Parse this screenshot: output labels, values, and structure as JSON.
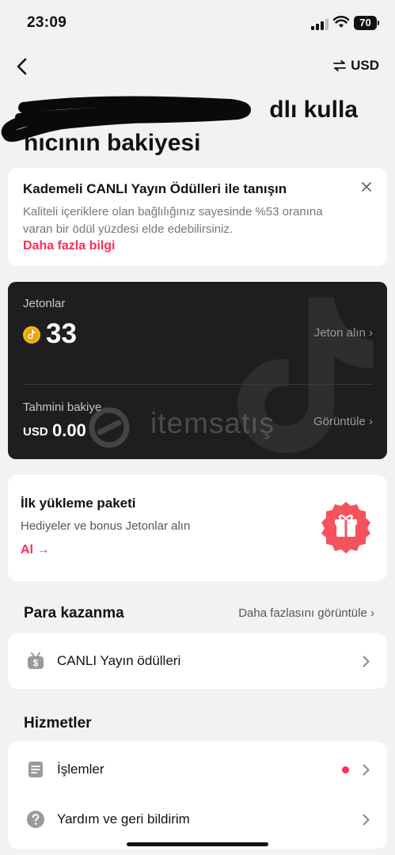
{
  "status": {
    "time": "23:09",
    "battery": "70"
  },
  "header": {
    "currency": "USD",
    "title": "…dlı kullanıcının bakiyesi",
    "title_line1": "dlı kulla",
    "title_line2": "nıcının bakiyesi"
  },
  "promo": {
    "title": "Kademeli CANLI Yayın Ödülleri ile tanışın",
    "description": "Kaliteli içeriklere olan bağlılığınız sayesinde %53 oranına varan bir ödül yüzdesi elde edebilirsiniz.",
    "link": "Daha fazla bilgi"
  },
  "balance": {
    "coins_label": "Jetonlar",
    "coins_value": "33",
    "get_coins": "Jeton alın ›",
    "estimated_label": "Tahmini bakiye",
    "estimated_currency": "USD",
    "estimated_value": "0.00",
    "view_label": "Görüntüle ›",
    "watermark": "itemsatış"
  },
  "starter_pack": {
    "title": "İlk yükleme paketi",
    "description": "Hediyeler ve bonus Jetonlar alın",
    "cta": "Al →"
  },
  "earning": {
    "title": "Para kazanma",
    "more": "Daha fazlasını görüntüle ›",
    "items": [
      {
        "label": "CANLI Yayın ödülleri",
        "icon": "tv-dollar-icon"
      }
    ]
  },
  "services": {
    "title": "Hizmetler",
    "items": [
      {
        "label": "İşlemler",
        "icon": "document-icon",
        "has_dot": true
      },
      {
        "label": "Yardım ve geri bildirim",
        "icon": "help-icon"
      }
    ]
  },
  "colors": {
    "accent": "#fe2c55",
    "card_dark": "#1e1e1e",
    "background": "#f2f2f2",
    "coin": "#f5b80f"
  }
}
